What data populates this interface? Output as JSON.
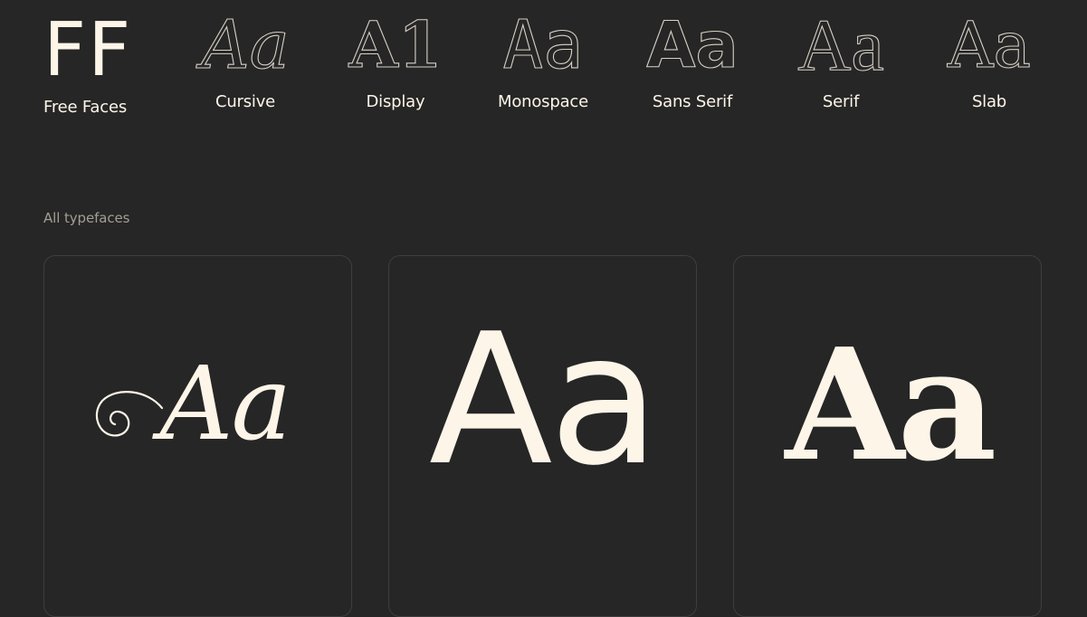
{
  "nav": {
    "logo": {
      "glyph": "FF",
      "label": "Free Faces"
    },
    "categories": [
      {
        "glyph": "Aa",
        "label": "Cursive"
      },
      {
        "glyph": "A1",
        "label": "Display"
      },
      {
        "glyph": "Aa",
        "label": "Monospace"
      },
      {
        "glyph": "Aa",
        "label": "Sans Serif"
      },
      {
        "glyph": "Aa",
        "label": "Serif"
      },
      {
        "glyph": "Aa",
        "label": "Slab"
      }
    ]
  },
  "section": {
    "heading": "All typefaces"
  },
  "cards": [
    {
      "sample": "Aa"
    },
    {
      "sample": "Aa"
    },
    {
      "sample": "Aa"
    }
  ],
  "colors": {
    "background": "#262626",
    "text": "#fdf5e8",
    "muted": "#a49e94",
    "card_border": "#3e3e3e"
  }
}
